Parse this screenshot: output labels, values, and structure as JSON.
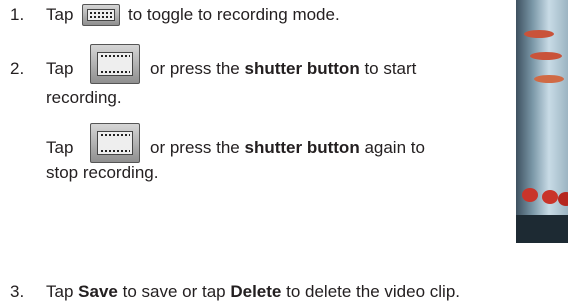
{
  "steps": [
    {
      "number": "1.",
      "parts": [
        "Tap",
        "to toggle to recording mode."
      ]
    },
    {
      "number": "2.",
      "parts": [
        "Tap",
        "or press the",
        "shutter button",
        "to start",
        "recording."
      ],
      "sub": {
        "parts": [
          "Tap",
          "or press the",
          "shutter button",
          "again to",
          "stop recording."
        ]
      }
    },
    {
      "number": "3.",
      "parts": [
        "Tap",
        "Save",
        "to save or tap",
        "Delete",
        "to delete the video clip."
      ]
    }
  ],
  "icons": {
    "step1": "video-mode-icon",
    "step2": "record-button-icon",
    "step2_sub": "record-button-icon"
  },
  "colors": {
    "text": "#231f20",
    "photo_bead": "#c9342a"
  }
}
